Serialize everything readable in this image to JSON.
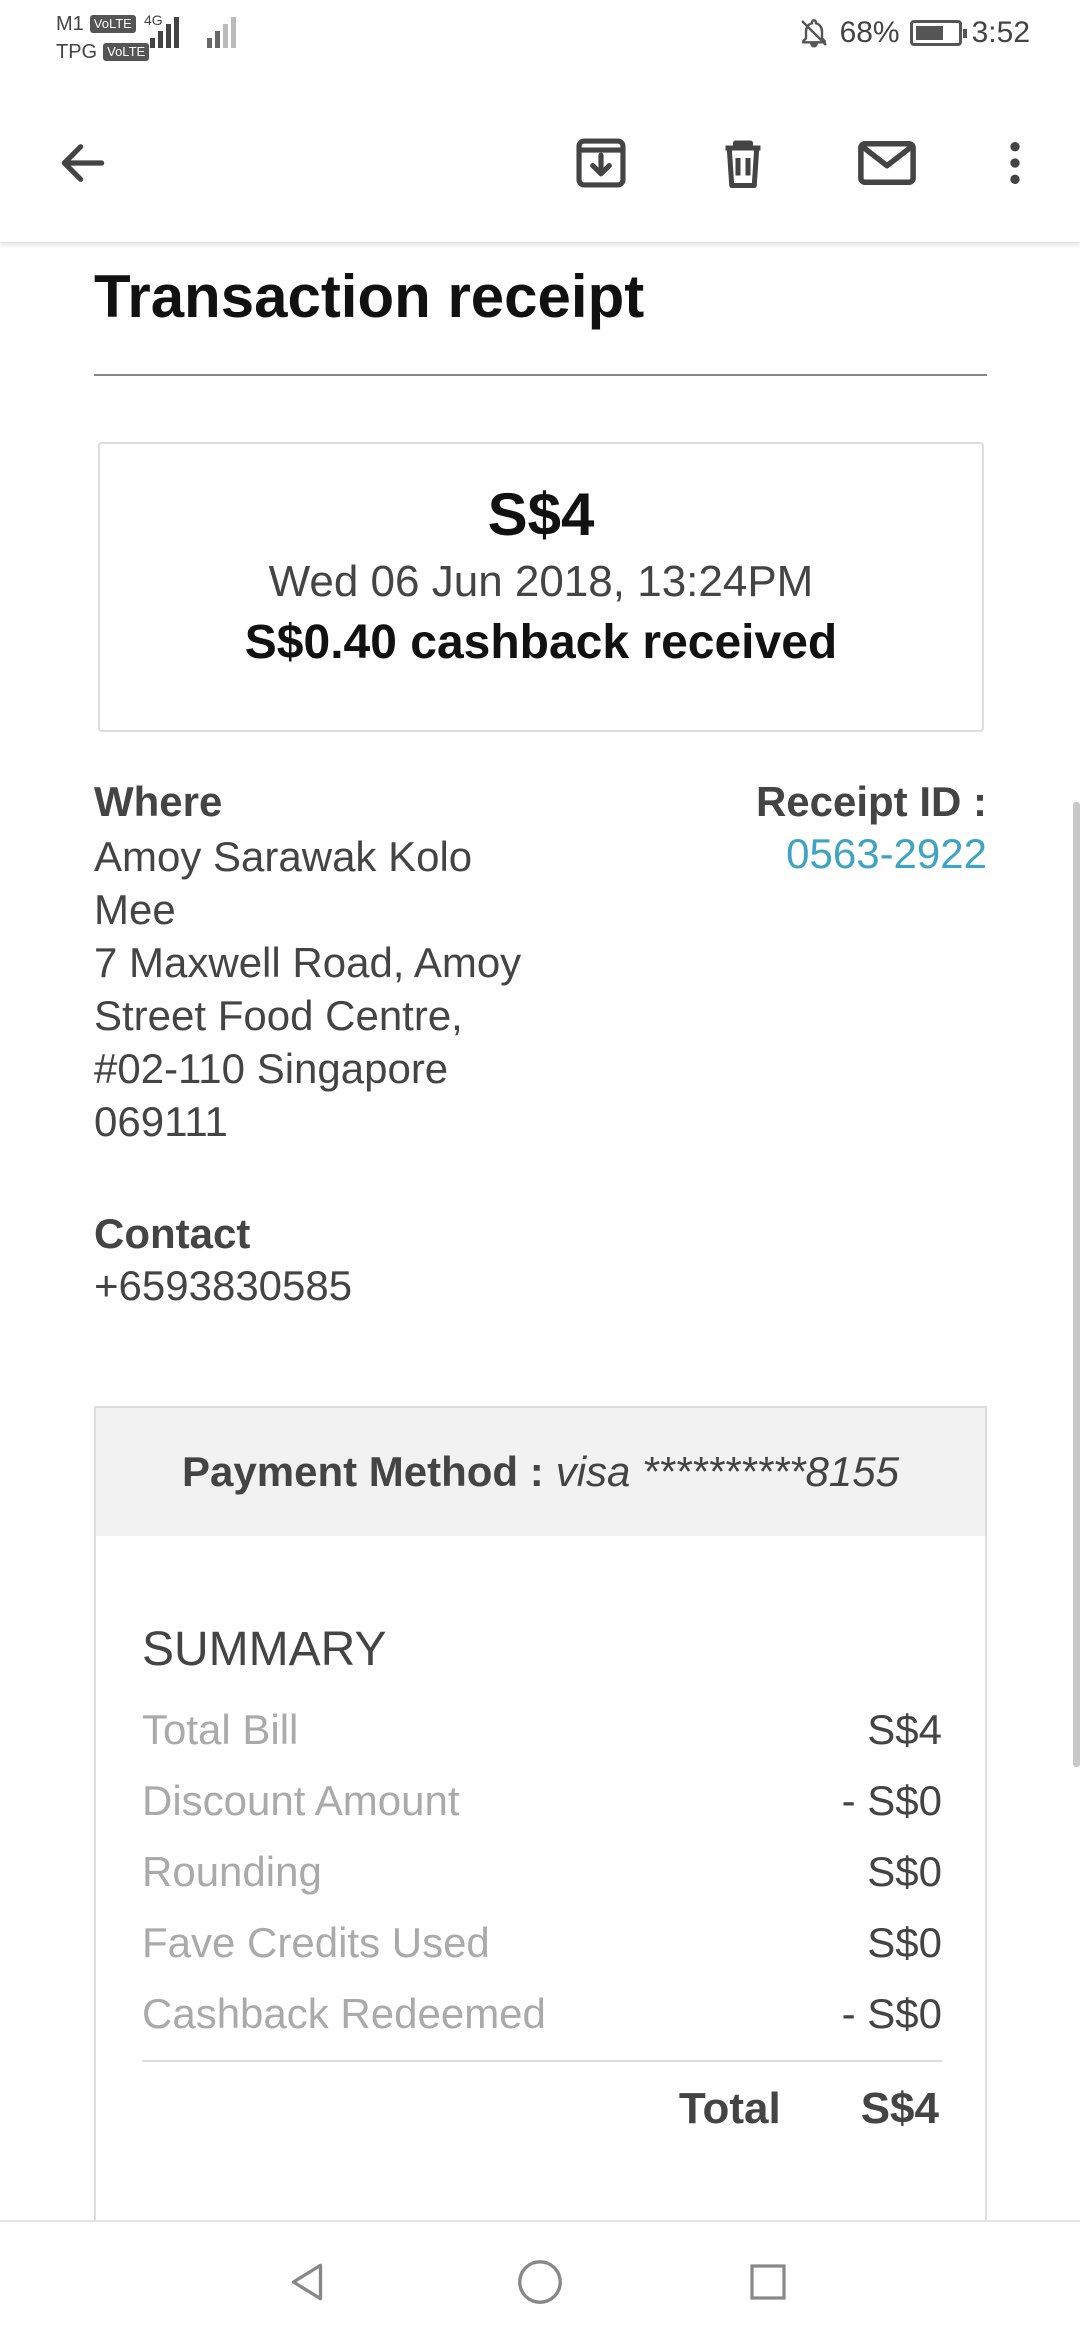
{
  "status_bar": {
    "carrier1": "M1",
    "carrier2": "TPG",
    "volte": "VoLTE",
    "network": "4G",
    "battery": "68%",
    "battery_level": 0.68,
    "time": "3:52"
  },
  "toolbar": {
    "back_icon": "arrow-left",
    "archive_icon": "archive",
    "delete_icon": "trash",
    "mark_unread_icon": "mail",
    "more_icon": "more-vertical"
  },
  "receipt": {
    "title": "Transaction receipt",
    "amount": "S$4",
    "datetime": "Wed 06 Jun 2018, 13:24PM",
    "cashback": "S$0.40 cashback received",
    "where_label": "Where",
    "address_lines": [
      "Amoy Sarawak Kolo",
      "Mee",
      "7 Maxwell Road, Amoy",
      "Street Food Centre,",
      "#02-110 Singapore",
      "069111"
    ],
    "receipt_id_label": "Receipt ID :",
    "receipt_id": "0563-2922",
    "contact_label": "Contact",
    "contact": "+6593830585"
  },
  "payment": {
    "label": "Payment Method :",
    "value": "visa **********8155"
  },
  "summary": {
    "title": "SUMMARY",
    "rows": [
      {
        "label": "Total Bill",
        "value": "S$4"
      },
      {
        "label": "Discount Amount",
        "value": "- S$0"
      },
      {
        "label": "Rounding",
        "value": "S$0"
      },
      {
        "label": "Fave Credits Used",
        "value": "S$0"
      },
      {
        "label": "Cashback Redeemed",
        "value": "- S$0"
      }
    ],
    "total_label": "Total",
    "total_value": "S$4"
  },
  "nav": {
    "back_icon": "triangle-back",
    "home_icon": "circle-home",
    "recents_icon": "square-recents"
  }
}
